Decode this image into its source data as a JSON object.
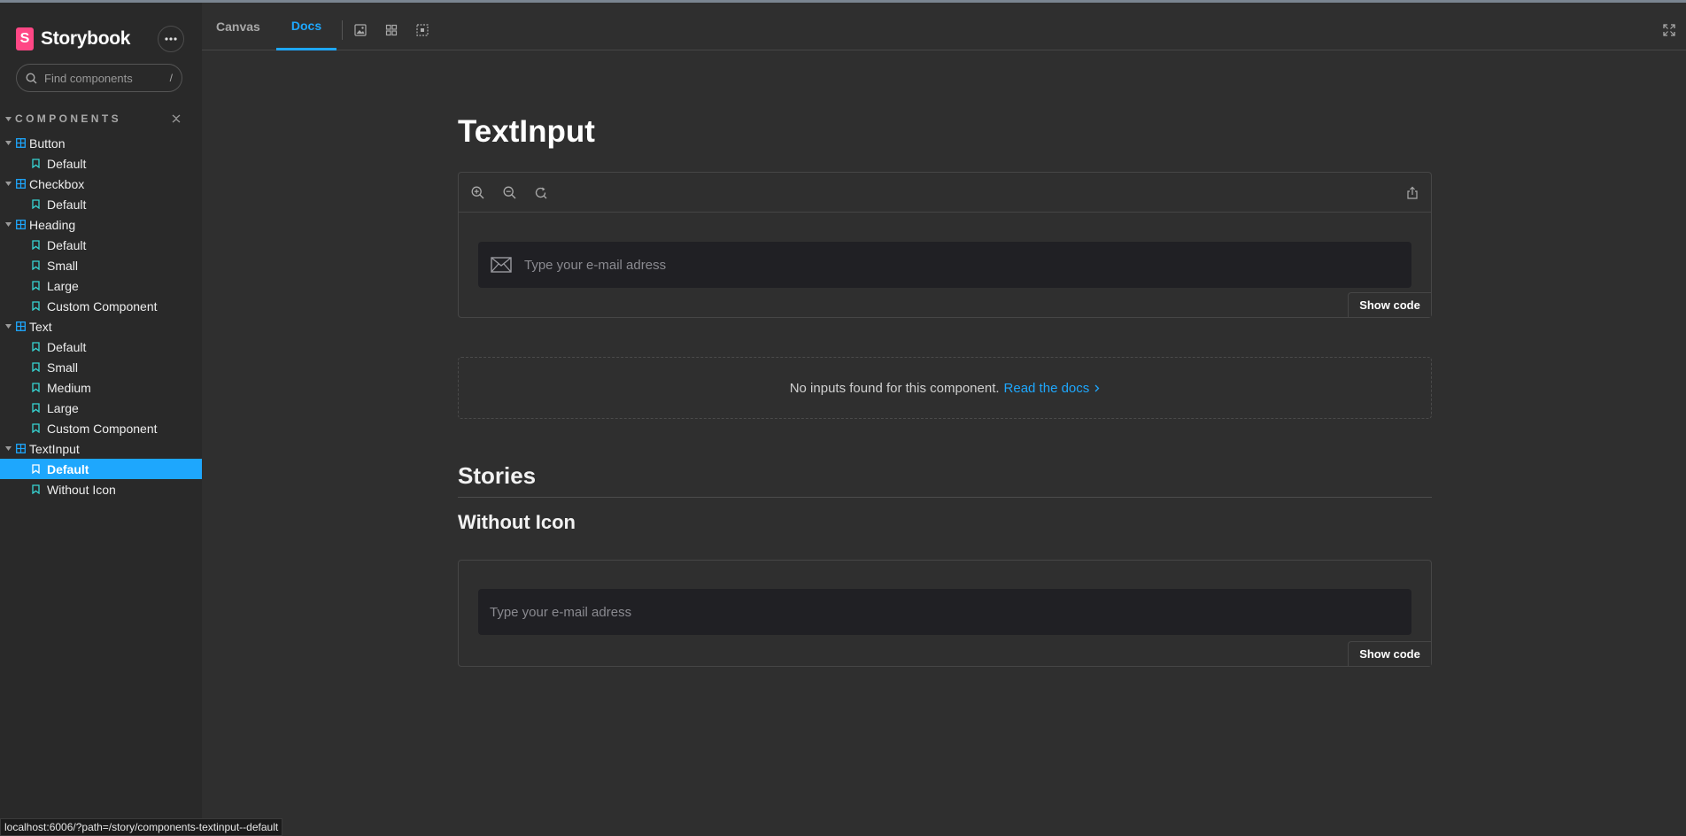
{
  "sidebar": {
    "brand": "Storybook",
    "logo_letter": "S",
    "search": {
      "placeholder": "Find components",
      "shortcut": "/"
    },
    "section": "COMPONENTS",
    "tree": [
      {
        "kind": "component",
        "label": "Button"
      },
      {
        "kind": "story",
        "label": "Default"
      },
      {
        "kind": "component",
        "label": "Checkbox"
      },
      {
        "kind": "story",
        "label": "Default"
      },
      {
        "kind": "component",
        "label": "Heading"
      },
      {
        "kind": "story",
        "label": "Default"
      },
      {
        "kind": "story",
        "label": "Small"
      },
      {
        "kind": "story",
        "label": "Large"
      },
      {
        "kind": "story",
        "label": "Custom Component"
      },
      {
        "kind": "component",
        "label": "Text"
      },
      {
        "kind": "story",
        "label": "Default"
      },
      {
        "kind": "story",
        "label": "Small"
      },
      {
        "kind": "story",
        "label": "Medium"
      },
      {
        "kind": "story",
        "label": "Large"
      },
      {
        "kind": "story",
        "label": "Custom Component"
      },
      {
        "kind": "component",
        "label": "TextInput"
      },
      {
        "kind": "story",
        "label": "Default",
        "active": true
      },
      {
        "kind": "story",
        "label": "Without Icon"
      }
    ]
  },
  "toolbar": {
    "tabs": {
      "canvas": "Canvas",
      "docs": "Docs"
    },
    "active_tab": "Docs",
    "icons": [
      "image-icon",
      "grid-icon",
      "outline-icon",
      "fullscreen-icon"
    ]
  },
  "docs": {
    "title": "TextInput",
    "primary_preview": {
      "placeholder": "Type your e-mail adress",
      "show_code": "Show code"
    },
    "no_inputs": {
      "text": "No inputs found for this component.",
      "link": "Read the docs"
    },
    "stories_heading": "Stories",
    "story": {
      "name": "Without Icon",
      "placeholder": "Type your e-mail adress",
      "show_code": "Show code"
    }
  },
  "status_url": "localhost:6006/?path=/story/components-textinput--default",
  "colors": {
    "accent": "#1ea7fd",
    "brand": "#ff4785",
    "background": "#2f2f2f",
    "sidebar": "#292929"
  }
}
